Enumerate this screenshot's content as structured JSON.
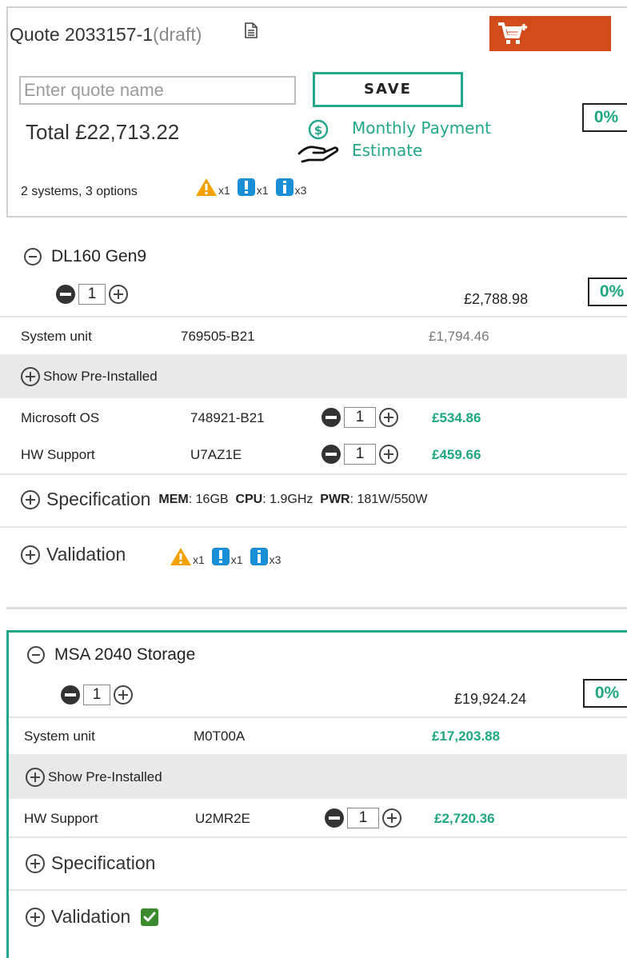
{
  "quote": {
    "title": "Quote 2033157-1",
    "status": "(draft)",
    "name_placeholder": "Enter quote name",
    "save_label": "SAVE",
    "discount": "0%",
    "total": "Total £22,713.22",
    "monthly_line1": "Monthly Payment",
    "monthly_line2": "Estimate",
    "summary": "2 systems, 3 options",
    "alerts": [
      {
        "type": "warning",
        "count": "x1"
      },
      {
        "type": "error",
        "count": "x1"
      },
      {
        "type": "info",
        "count": "x3"
      }
    ]
  },
  "colors": {
    "accent": "#22a78a",
    "price_green": "#1ea77f",
    "cart": "#d24b1a",
    "warning": "#f2a100",
    "info": "#1a8fd6"
  },
  "systems": [
    {
      "name": "DL160 Gen9",
      "qty": "1",
      "price": "£2,788.98",
      "discount": "0%",
      "unit_label": "System unit",
      "unit_sku": "769505-B21",
      "unit_price": "£1,794.46",
      "preinstalled_label": "Show Pre-Installed",
      "options": [
        {
          "label": "Microsoft OS",
          "sku": "748921-B21",
          "qty": "1",
          "price": "£534.86"
        },
        {
          "label": "HW Support",
          "sku": "U7AZ1E",
          "qty": "1",
          "price": "£459.66"
        }
      ],
      "spec_label": "Specification",
      "spec": [
        {
          "key": "MEM",
          "value": ": 16GB"
        },
        {
          "key": "CPU",
          "value": ": 1.9GHz"
        },
        {
          "key": "PWR",
          "value": ": 181W/550W"
        }
      ],
      "validation_label": "Validation",
      "alerts": [
        {
          "type": "warning",
          "count": "x1"
        },
        {
          "type": "error",
          "count": "x1"
        },
        {
          "type": "info",
          "count": "x3"
        }
      ]
    },
    {
      "name": "MSA 2040 Storage",
      "qty": "1",
      "price": "£19,924.24",
      "discount": "0%",
      "unit_label": "System unit",
      "unit_sku": "M0T00A",
      "unit_price": "£17,203.88",
      "preinstalled_label": "Show Pre-Installed",
      "options": [
        {
          "label": "HW Support",
          "sku": "U2MR2E",
          "qty": "1",
          "price": "£2,720.36"
        }
      ],
      "spec_label": "Specification",
      "validation_label": "Validation",
      "validation_status": "valid"
    }
  ]
}
